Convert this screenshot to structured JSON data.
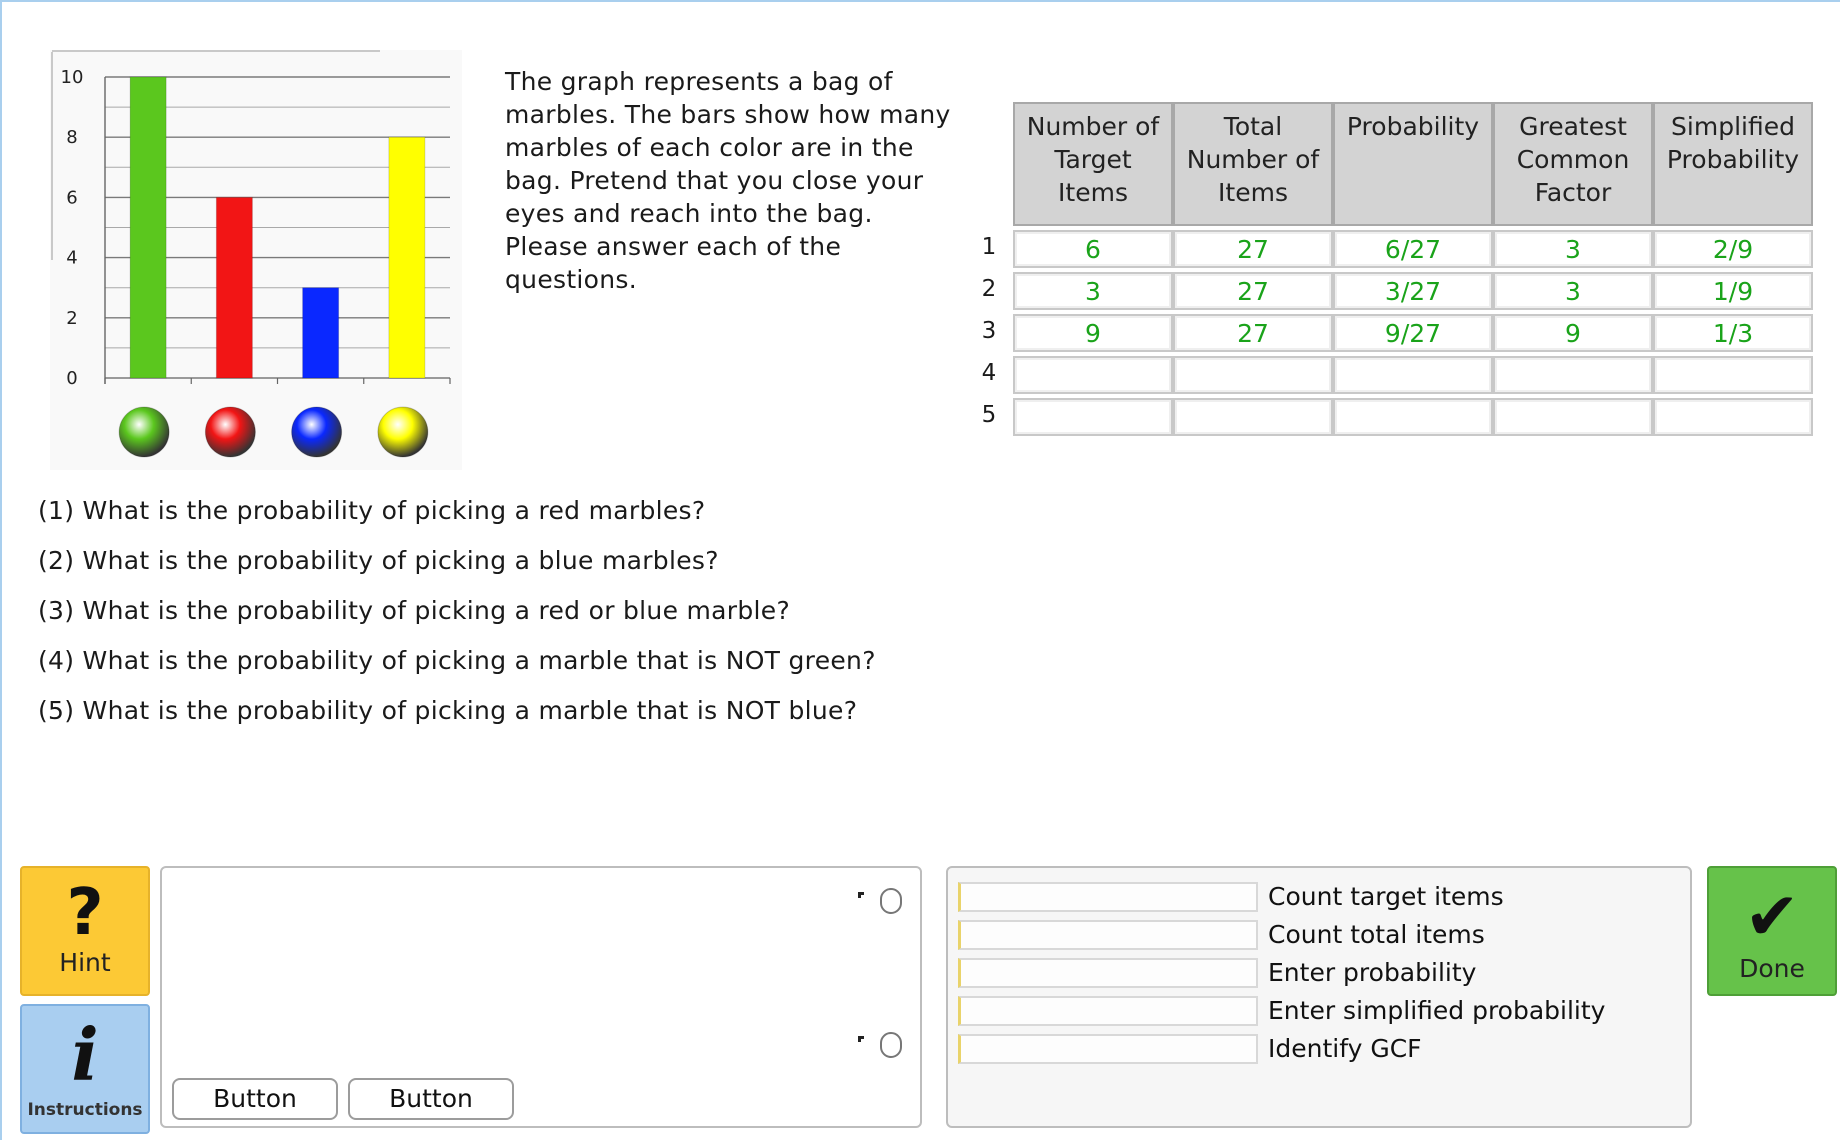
{
  "colors": {
    "green": "#5bc71e",
    "red": "#f21515",
    "blue": "#0a28ff",
    "yellow": "#ffff00",
    "correct_text": "#1aa31a",
    "hint": "#fcc935",
    "instructions": "#a9cef0",
    "done": "#66c24a"
  },
  "chart_data": {
    "type": "bar",
    "categories": [
      "green",
      "red",
      "blue",
      "yellow"
    ],
    "values": [
      10,
      6,
      3,
      8
    ],
    "bar_colors": [
      "#5bc71e",
      "#f21515",
      "#0a28ff",
      "#ffff00"
    ],
    "ylim": [
      0,
      10
    ],
    "ytick_labels": [
      "0",
      "2",
      "4",
      "6",
      "8",
      "10"
    ],
    "minor_grid_step": 1,
    "category_icons": [
      "green-marble-icon",
      "red-marble-icon",
      "blue-marble-icon",
      "yellow-marble-icon"
    ],
    "grid": true
  },
  "description": "The graph represents a bag of marbles. The bars show how many marbles of each color are in the bag. Pretend that you close your eyes and reach into the bag. Please answer each of the questions.",
  "table": {
    "headers": [
      [
        "Number of",
        "Target",
        "Items"
      ],
      [
        "Total",
        "Number of",
        "Items"
      ],
      [
        "Probability"
      ],
      [
        "Greatest",
        "Common",
        "Factor"
      ],
      [
        "Simplified",
        "Probability"
      ]
    ],
    "row_numbers": [
      "1",
      "2",
      "3",
      "4",
      "5"
    ],
    "rows": [
      [
        "6",
        "27",
        "6/27",
        "3",
        "2/9"
      ],
      [
        "3",
        "27",
        "3/27",
        "3",
        "1/9"
      ],
      [
        "9",
        "27",
        "9/27",
        "9",
        "1/3"
      ],
      [
        "",
        "",
        "",
        "",
        ""
      ],
      [
        "",
        "",
        "",
        "",
        ""
      ]
    ]
  },
  "questions": [
    "(1) What is the probability of picking a red marbles?",
    "(2) What is the probability of picking a blue marbles?",
    "(3) What is the probability of picking a red or blue marble?",
    "(4) What is the probability of picking a marble that is NOT green?",
    "(5) What is the probability of picking a marble that is NOT blue?"
  ],
  "toolbar": {
    "hint_label": "Hint",
    "hint_icon": "question-mark-icon",
    "instructions_label": "Instructions",
    "instructions_icon": "info-icon",
    "done_label": "Done",
    "done_icon": "checkmark-icon"
  },
  "message_panel": {
    "button1_label": "Button",
    "button2_label": "Button"
  },
  "skills": [
    "Count target items",
    "Count total items",
    "Enter probability",
    "Enter simplified probability",
    "Identify GCF"
  ]
}
